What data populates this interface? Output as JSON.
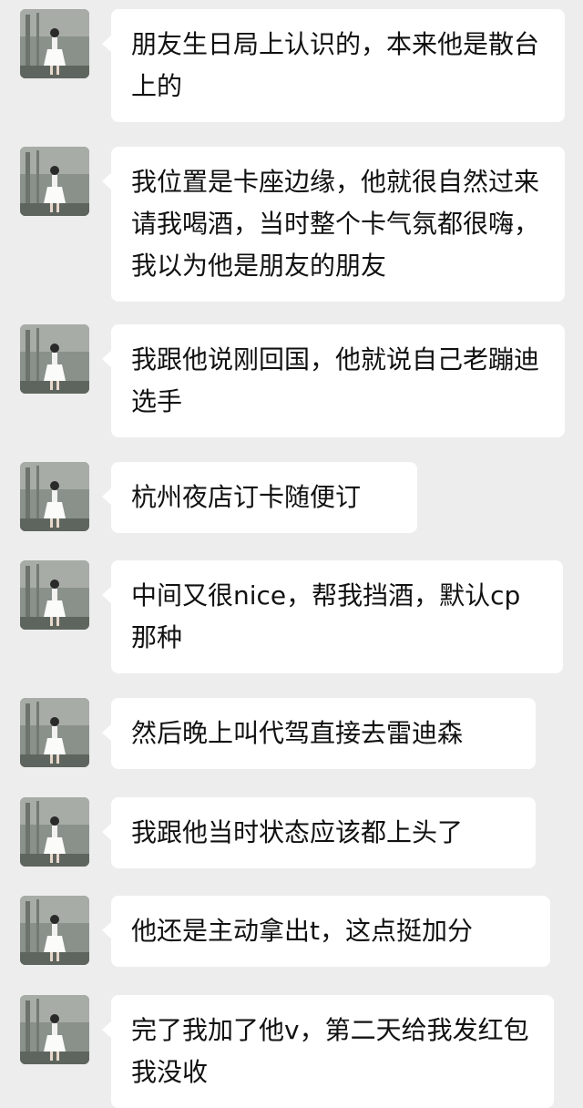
{
  "chat": {
    "background_color": "#ededed",
    "bubble_color": "#ffffff",
    "avatar_icon": "avatar-girl-white-dress-icon",
    "messages": [
      {
        "text": "朋友生日局上认识的，本来他是散台上的"
      },
      {
        "text": "我位置是卡座边缘，他就很自然过来请我喝酒，当时整个卡气氛都很嗨，我以为他是朋友的朋友"
      },
      {
        "text": "我跟他说刚回国，他就说自己老蹦迪选手"
      },
      {
        "text": "杭州夜店订卡随便订"
      },
      {
        "text": "中间又很nice，帮我挡酒，默认cp那种"
      },
      {
        "text": "然后晚上叫代驾直接去雷迪森"
      },
      {
        "text": "我跟他当时状态应该都上头了"
      },
      {
        "text": "他还是主动拿出t，这点挺加分"
      },
      {
        "text": "完了我加了他v，第二天给我发红包我没收"
      }
    ]
  }
}
